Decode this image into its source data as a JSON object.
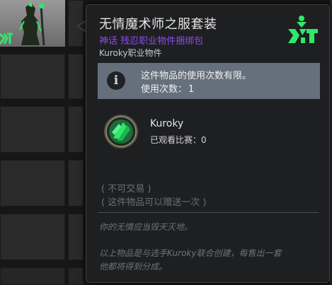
{
  "tooltip": {
    "title": "无情魔术师之服套装",
    "rarity": "神话 残忍职业物件捆绑包",
    "item_type": "Kuroky职业物件",
    "notice": {
      "line1": "这件物品的使用次数有限。",
      "uses_label": "使用次数：",
      "uses_value": "1"
    },
    "player": {
      "name": "Kuroky",
      "stat_label": "已观看比赛：",
      "stat_value": "0"
    },
    "trade_lines": [
      "( 不可交易 )",
      "( 这件物品可以赠送一次 )"
    ],
    "flavor": "你的无情应当毁天灭地。",
    "footer_lines": [
      "以上物品是与选手Kuroky联合创建，每售出一套",
      "他都将得到分成。"
    ]
  },
  "colors": {
    "rarity": "#8b4cf0",
    "notice_bg": "#65707c",
    "brand_green": "#2ee86b"
  },
  "icons": {
    "info": "info-icon",
    "brand": "team-logo-icon",
    "avatar": "player-avatar-icon"
  }
}
